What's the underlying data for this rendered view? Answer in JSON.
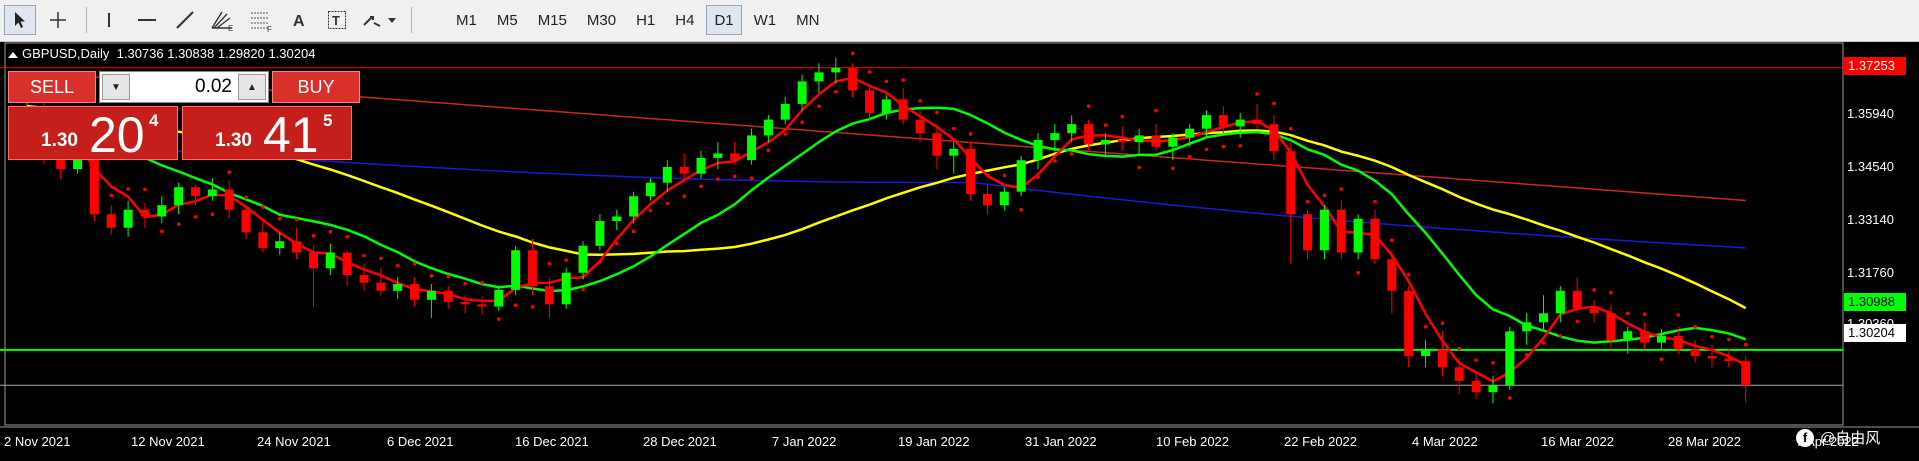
{
  "toolbar": {
    "tools": [
      "cursor",
      "crosshair",
      "vertical-line",
      "horizontal-line",
      "trendline",
      "fibonacci-fan",
      "fibonacci-retracement",
      "text",
      "text-label",
      "arrows"
    ],
    "timeframes": [
      "M1",
      "M5",
      "M15",
      "M30",
      "H1",
      "H4",
      "D1",
      "W1",
      "MN"
    ],
    "active_timeframe": "D1"
  },
  "chart": {
    "symbol_label": "GBPUSD,Daily  1.30736 1.30838 1.29820 1.30204",
    "colors": {
      "bull": "#00ff00",
      "bear": "#ff0000",
      "sar": "#ff0000",
      "ma_fast": "#ff0000",
      "ma_mid": "#00ff00",
      "ma_slow": "#ffff00",
      "ma_100": "#1a1adc",
      "ma_200": "#c8281e",
      "level_line": "#00ff00"
    }
  },
  "trade_panel": {
    "sell_label": "SELL",
    "buy_label": "BUY",
    "lot": "0.02",
    "bid": {
      "prefix": "1.30",
      "big": "20",
      "sup": "4"
    },
    "ask": {
      "prefix": "1.30",
      "big": "41",
      "sup": "5"
    }
  },
  "price_axis": {
    "labels": [
      "1.37253",
      "1.35940",
      "1.34540",
      "1.33140",
      "1.31760",
      "1.30988",
      "1.30360",
      "1.30204"
    ],
    "highlight_red": "1.37253",
    "highlight_green": "1.30988",
    "current": "1.30204"
  },
  "date_axis": [
    "2 Nov 2021",
    "12 Nov 2021",
    "24 Nov 2021",
    "6 Dec 2021",
    "16 Dec 2021",
    "28 Dec 2021",
    "7 Jan 2022",
    "19 Jan 2022",
    "31 Jan 2022",
    "10 Feb 2022",
    "22 Feb 2022",
    "4 Mar 2022",
    "16 Mar 2022",
    "28 Mar 2022",
    "7 Apr 2022"
  ],
  "watermark": "@自由风",
  "chart_data": {
    "type": "candlestick",
    "symbol": "GBPUSD",
    "timeframe": "Daily",
    "last_bar": {
      "open": 1.30736,
      "high": 1.30838,
      "low": 1.2982,
      "close": 1.30204
    },
    "level_line": 1.30988,
    "red_level_line": 1.37253,
    "candles": [
      [
        1.3615,
        1.3662,
        1.3584,
        1.364
      ],
      [
        1.364,
        1.3668,
        1.3512,
        1.353
      ],
      [
        1.353,
        1.356,
        1.3478,
        1.35
      ],
      [
        1.35,
        1.359,
        1.349,
        1.3575
      ],
      [
        1.3575,
        1.359,
        1.3385,
        1.34
      ],
      [
        1.34,
        1.342,
        1.3355,
        1.337
      ],
      [
        1.337,
        1.343,
        1.335,
        1.341
      ],
      [
        1.341,
        1.3425,
        1.337,
        1.3395
      ],
      [
        1.3395,
        1.344,
        1.338,
        1.342
      ],
      [
        1.342,
        1.347,
        1.34,
        1.346
      ],
      [
        1.346,
        1.3465,
        1.342,
        1.344
      ],
      [
        1.344,
        1.348,
        1.343,
        1.3455
      ],
      [
        1.3455,
        1.3475,
        1.339,
        1.341
      ],
      [
        1.341,
        1.3415,
        1.3345,
        1.336
      ],
      [
        1.336,
        1.339,
        1.3315,
        1.3325
      ],
      [
        1.3325,
        1.336,
        1.331,
        1.334
      ],
      [
        1.334,
        1.337,
        1.33,
        1.3315
      ],
      [
        1.3315,
        1.333,
        1.3195,
        1.328
      ],
      [
        1.328,
        1.3335,
        1.3265,
        1.3315
      ],
      [
        1.3315,
        1.332,
        1.324,
        1.3265
      ],
      [
        1.3265,
        1.329,
        1.323,
        1.3248
      ],
      [
        1.3248,
        1.328,
        1.322,
        1.323
      ],
      [
        1.323,
        1.326,
        1.3212,
        1.3245
      ],
      [
        1.3245,
        1.326,
        1.3195,
        1.321
      ],
      [
        1.321,
        1.3245,
        1.317,
        1.323
      ],
      [
        1.323,
        1.324,
        1.319,
        1.3205
      ],
      [
        1.3205,
        1.322,
        1.318,
        1.32
      ],
      [
        1.32,
        1.3218,
        1.3178,
        1.3195
      ],
      [
        1.3195,
        1.324,
        1.3185,
        1.3232
      ],
      [
        1.3232,
        1.333,
        1.322,
        1.332
      ],
      [
        1.332,
        1.3345,
        1.322,
        1.324
      ],
      [
        1.324,
        1.326,
        1.317,
        1.32
      ],
      [
        1.32,
        1.328,
        1.319,
        1.327
      ],
      [
        1.327,
        1.334,
        1.3255,
        1.333
      ],
      [
        1.333,
        1.34,
        1.332,
        1.3385
      ],
      [
        1.3385,
        1.341,
        1.3365,
        1.3395
      ],
      [
        1.3395,
        1.345,
        1.338,
        1.344
      ],
      [
        1.344,
        1.348,
        1.343,
        1.347
      ],
      [
        1.347,
        1.352,
        1.345,
        1.3505
      ],
      [
        1.3505,
        1.3535,
        1.347,
        1.349
      ],
      [
        1.349,
        1.354,
        1.348,
        1.3525
      ],
      [
        1.3525,
        1.356,
        1.35,
        1.3535
      ],
      [
        1.3535,
        1.356,
        1.351,
        1.352
      ],
      [
        1.352,
        1.359,
        1.351,
        1.3575
      ],
      [
        1.3575,
        1.362,
        1.356,
        1.361
      ],
      [
        1.361,
        1.366,
        1.36,
        1.3645
      ],
      [
        1.3645,
        1.371,
        1.363,
        1.3695
      ],
      [
        1.3695,
        1.3735,
        1.367,
        1.3715
      ],
      [
        1.3715,
        1.3748,
        1.369,
        1.3725
      ],
      [
        1.3725,
        1.3735,
        1.366,
        1.3675
      ],
      [
        1.3675,
        1.369,
        1.361,
        1.3625
      ],
      [
        1.3625,
        1.3665,
        1.361,
        1.3655
      ],
      [
        1.3655,
        1.368,
        1.36,
        1.361
      ],
      [
        1.361,
        1.363,
        1.356,
        1.358
      ],
      [
        1.358,
        1.36,
        1.35,
        1.353
      ],
      [
        1.353,
        1.356,
        1.349,
        1.3545
      ],
      [
        1.3545,
        1.356,
        1.343,
        1.3445
      ],
      [
        1.3445,
        1.3465,
        1.34,
        1.342
      ],
      [
        1.342,
        1.346,
        1.3408,
        1.345
      ],
      [
        1.345,
        1.353,
        1.344,
        1.352
      ],
      [
        1.352,
        1.358,
        1.35,
        1.3565
      ],
      [
        1.3565,
        1.36,
        1.354,
        1.358
      ],
      [
        1.358,
        1.362,
        1.356,
        1.36
      ],
      [
        1.36,
        1.361,
        1.354,
        1.3555
      ],
      [
        1.3555,
        1.358,
        1.353,
        1.3565
      ],
      [
        1.3565,
        1.3595,
        1.354,
        1.356
      ],
      [
        1.356,
        1.359,
        1.353,
        1.3575
      ],
      [
        1.3575,
        1.36,
        1.354,
        1.355
      ],
      [
        1.355,
        1.358,
        1.352,
        1.357
      ],
      [
        1.357,
        1.36,
        1.355,
        1.359
      ],
      [
        1.359,
        1.363,
        1.357,
        1.362
      ],
      [
        1.362,
        1.364,
        1.358,
        1.3595
      ],
      [
        1.3595,
        1.3625,
        1.357,
        1.361
      ],
      [
        1.361,
        1.3645,
        1.359,
        1.36
      ],
      [
        1.36,
        1.362,
        1.352,
        1.354
      ],
      [
        1.354,
        1.356,
        1.329,
        1.34
      ],
      [
        1.34,
        1.341,
        1.33,
        1.332
      ],
      [
        1.332,
        1.342,
        1.33,
        1.341
      ],
      [
        1.341,
        1.343,
        1.33,
        1.3315
      ],
      [
        1.3315,
        1.34,
        1.33,
        1.339
      ],
      [
        1.339,
        1.341,
        1.329,
        1.33
      ],
      [
        1.33,
        1.332,
        1.318,
        1.323
      ],
      [
        1.323,
        1.324,
        1.306,
        1.3085
      ],
      [
        1.3085,
        1.312,
        1.306,
        1.31
      ],
      [
        1.31,
        1.314,
        1.304,
        1.306
      ],
      [
        1.306,
        1.308,
        1.3,
        1.303
      ],
      [
        1.303,
        1.305,
        1.299,
        1.3005
      ],
      [
        1.3005,
        1.304,
        1.298,
        1.302
      ],
      [
        1.302,
        1.315,
        1.301,
        1.314
      ],
      [
        1.314,
        1.318,
        1.311,
        1.316
      ],
      [
        1.316,
        1.322,
        1.314,
        1.318
      ],
      [
        1.318,
        1.324,
        1.316,
        1.323
      ],
      [
        1.323,
        1.326,
        1.318,
        1.319
      ],
      [
        1.319,
        1.321,
        1.316,
        1.318
      ],
      [
        1.318,
        1.32,
        1.31,
        1.312
      ],
      [
        1.312,
        1.315,
        1.309,
        1.314
      ],
      [
        1.314,
        1.316,
        1.31,
        1.3115
      ],
      [
        1.3115,
        1.3145,
        1.31,
        1.313
      ],
      [
        1.313,
        1.315,
        1.309,
        1.31
      ],
      [
        1.31,
        1.312,
        1.307,
        1.3085
      ],
      [
        1.3085,
        1.311,
        1.306,
        1.308
      ],
      [
        1.308,
        1.31,
        1.306,
        1.3074
      ],
      [
        1.3074,
        1.3084,
        1.2982,
        1.302
      ]
    ]
  }
}
